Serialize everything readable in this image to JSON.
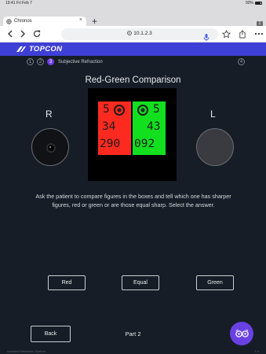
{
  "status_bar": {
    "time": "19:41  Fri Feb 7",
    "battery": "90%"
  },
  "browser": {
    "tab_title": "Chronos",
    "tab_close": "×",
    "new_tab": "+",
    "tab_count": "1",
    "url": "10.1.2.3"
  },
  "app": {
    "brand": "TOPCON",
    "steps": [
      {
        "number": "1",
        "state": "done"
      },
      {
        "number": "2",
        "state": "done"
      },
      {
        "number": "3",
        "state": "active",
        "label": "Subjective Refraction"
      },
      {
        "number": "4",
        "state": "pending"
      }
    ],
    "title": "Red-Green Comparison",
    "chart": {
      "red_row1": "5",
      "red_row2": "34",
      "red_row3": "290",
      "green_row1": "5",
      "green_row2": "43",
      "green_row3": "092",
      "colors": {
        "red": "#ff2a1f",
        "green": "#12e01f"
      }
    },
    "right_eye_label": "R",
    "left_eye_label": "L",
    "instruction": "Ask the patient to compare figures in the boxes and tell which one has sharper figures, red or green or are those equal sharp. Select the answer.",
    "answers": {
      "red": "Red",
      "equal": "Equal",
      "green": "Green"
    },
    "back": "Back",
    "part": "Part 2",
    "footer_left": "Assisted Refraction System",
    "footer_right": "1.0",
    "accent": "#6941e3",
    "brand_color": "#3e3fd4"
  }
}
